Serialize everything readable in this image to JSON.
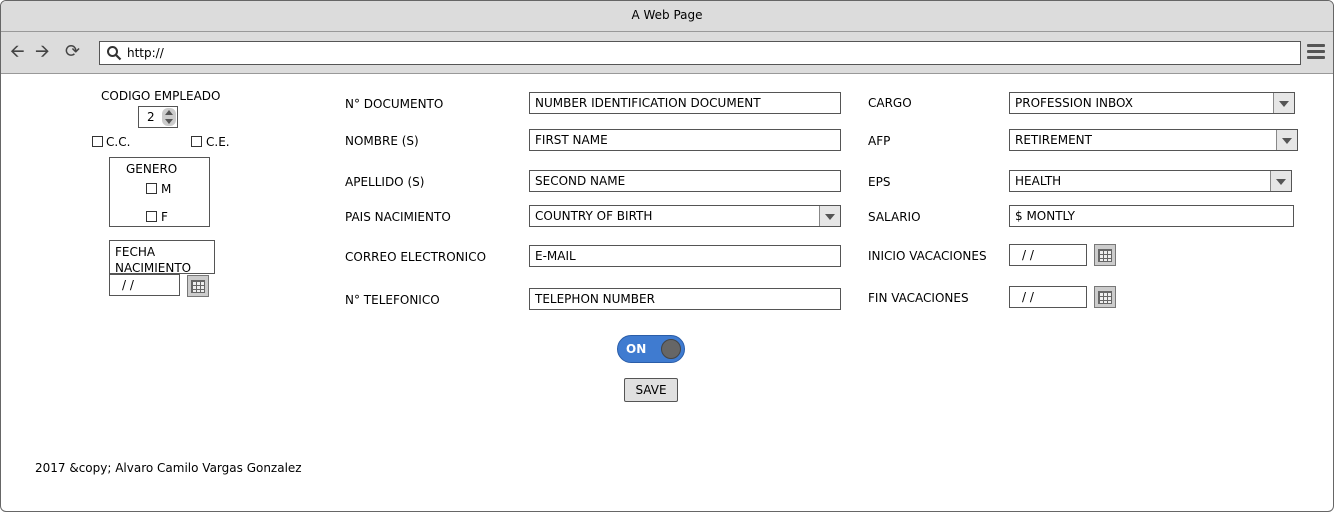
{
  "window": {
    "title": "A Web Page"
  },
  "browser": {
    "url": "http://"
  },
  "employee": {
    "code_label": "CODIGO EMPLEADO",
    "code_value": "2",
    "cc_label": "C.C.",
    "ce_label": "C.E.",
    "gender_label": "GENERO",
    "male_label": "M",
    "female_label": "F",
    "birth_label": "FECHA NACIMIENTO",
    "birth_value": " /  /"
  },
  "form_left": {
    "doc_label": "N° DOCUMENTO",
    "doc_value": "NUMBER IDENTIFICATION DOCUMENT",
    "name_label": "NOMBRE (S)",
    "name_value": "FIRST NAME",
    "surname_label": "APELLIDO (S)",
    "surname_value": "SECOND NAME",
    "country_label": "PAIS NACIMIENTO",
    "country_value": "COUNTRY OF BIRTH",
    "email_label": "CORREO ELECTRONICO",
    "email_value": "E-MAIL",
    "phone_label": "N° TELEFONICO",
    "phone_value": "TELEPHON NUMBER"
  },
  "form_right": {
    "cargo_label": "CARGO",
    "cargo_value": "PROFESSION INBOX",
    "afp_label": "AFP",
    "afp_value": "RETIREMENT",
    "eps_label": "EPS",
    "eps_value": "HEALTH",
    "salary_label": "SALARIO",
    "salary_value": "$ MONTLY",
    "vac_start_label": "INICIO VACACIONES",
    "vac_start_value": " /  /",
    "vac_end_label": "FIN VACACIONES",
    "vac_end_value": " /  /"
  },
  "actions": {
    "toggle_label": "ON",
    "save_label": "SAVE"
  },
  "footer": {
    "text": "2017 &copy; Alvaro Camilo Vargas Gonzalez"
  },
  "colors": {
    "toggle_on": "#3f7bd0",
    "chrome": "#dcdcdc"
  }
}
